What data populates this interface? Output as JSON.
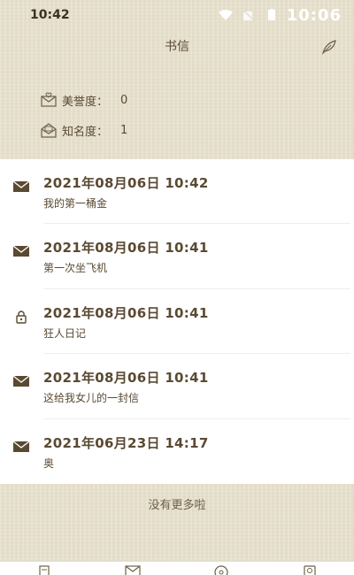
{
  "status_bar": {
    "time": "10:42",
    "clock_overlay": "10:06"
  },
  "nav": {
    "title": "书信",
    "action_icon": "feather-pen-icon"
  },
  "stats": [
    {
      "label": "美誉度：",
      "value": "0",
      "icon": "mail-heart-icon"
    },
    {
      "label": "知名度：",
      "value": "1",
      "icon": "mail-open-icon"
    }
  ],
  "letters": [
    {
      "date": "2021年08月06日 10:42",
      "title": "我的第一桶金",
      "icon": "envelope-icon"
    },
    {
      "date": "2021年08月06日 10:41",
      "title": "第一次坐飞机",
      "icon": "envelope-icon"
    },
    {
      "date": "2021年08月06日 10:41",
      "title": "狂人日记",
      "icon": "lock-icon"
    },
    {
      "date": "2021年08月06日 10:41",
      "title": "这给我女儿的一封信",
      "icon": "envelope-icon"
    },
    {
      "date": "2021年06月23日 14:17",
      "title": "奥",
      "icon": "envelope-icon"
    }
  ],
  "footer": {
    "no_more": "没有更多啦"
  },
  "tabs": [
    {
      "icon": "document-icon"
    },
    {
      "icon": "envelope-icon"
    },
    {
      "icon": "compass-icon"
    },
    {
      "icon": "user-icon"
    }
  ],
  "colors": {
    "paper_bg": "#e9e2cf",
    "text_brown": "#5a4a32",
    "list_bg": "#ffffff"
  }
}
